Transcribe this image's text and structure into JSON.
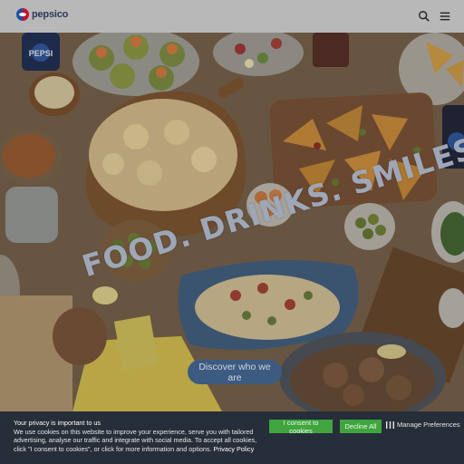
{
  "header": {
    "brand": "pepsico",
    "icons": [
      "search-icon",
      "menu-icon"
    ]
  },
  "hero": {
    "tagline": "FOOD. DRINKS. SMILES.",
    "cta_label": "Discover who we are",
    "can_label": "PEPSI"
  },
  "cookie_banner": {
    "title": "Your privacy is important to us",
    "body": "We use cookies on this website to improve your experience, serve you with tailored advertising, analyse our traffic and integrate with social media. To accept all cookies, click \"I consent to cookies\", or click for more information and options.",
    "policy_link": "Privacy Policy",
    "consent_label": "I consent to cookies",
    "decline_label": "Decline All",
    "manage_label": "Manage Preferences"
  },
  "colors": {
    "header_bg": "#b8b8b8",
    "cta_bg": "#3d5b80",
    "cookie_bg": "#262e3a",
    "button_green": "#40a53f"
  }
}
